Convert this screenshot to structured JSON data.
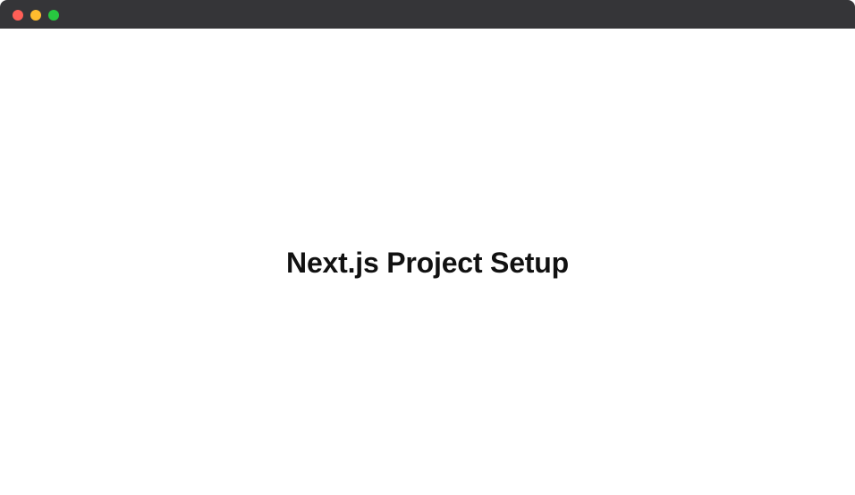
{
  "window": {
    "controls": {
      "close": {
        "icon": "close-dot-icon",
        "color": "#FF5F57"
      },
      "minimize": {
        "icon": "minimize-dot-icon",
        "color": "#FEBC2E"
      },
      "maximize": {
        "icon": "maximize-dot-icon",
        "color": "#28C840"
      }
    }
  },
  "main": {
    "title": "Next.js Project Setup"
  }
}
